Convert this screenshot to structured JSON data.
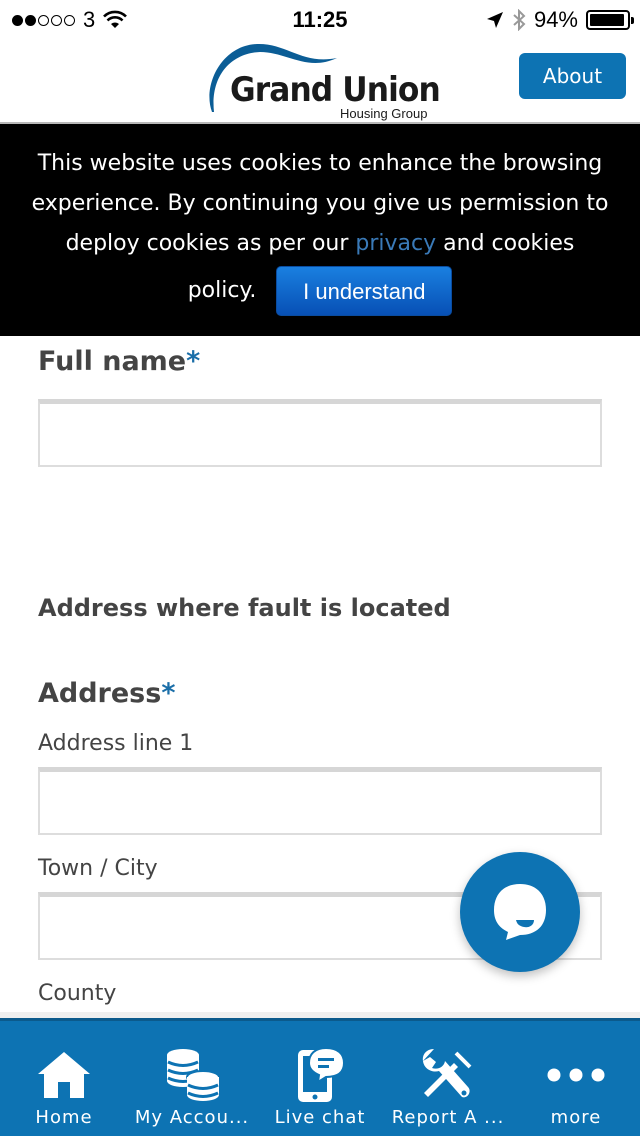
{
  "status_bar": {
    "carrier": "3",
    "signal_bars_filled": 2,
    "signal_bars_total": 5,
    "time": "11:25",
    "battery_percent": "94%",
    "battery_level": 0.94
  },
  "header": {
    "logo_title": "Grand Union",
    "logo_subtitle": "Housing Group",
    "about_label": "About",
    "brand_color": "#0d73b3"
  },
  "cookie_banner": {
    "text_before_link": "This website uses cookies to enhance the browsing experience. By continuing you give us permission to deploy cookies as per our ",
    "link_text": "privacy",
    "text_after_link": " and cookies",
    "text_last": "policy.",
    "button_label": "I understand"
  },
  "form": {
    "full_name": {
      "label": "Full name",
      "required_mark": "*",
      "value": ""
    },
    "section_heading": "Address where fault is located",
    "address": {
      "label": "Address",
      "required_mark": "*",
      "line1": {
        "label": "Address line 1",
        "value": ""
      },
      "town": {
        "label": "Town / City",
        "value": ""
      },
      "county": {
        "label": "County"
      }
    }
  },
  "chat_fab": {
    "icon": "chat-bubble-icon"
  },
  "tabbar": {
    "items": [
      {
        "label": "Home",
        "icon": "home-icon"
      },
      {
        "label": "My Accou...",
        "icon": "coins-icon"
      },
      {
        "label": "Live chat",
        "icon": "phone-chat-icon"
      },
      {
        "label": "Report A ...",
        "icon": "tools-icon"
      },
      {
        "label": "more",
        "icon": "more-icon"
      }
    ]
  }
}
